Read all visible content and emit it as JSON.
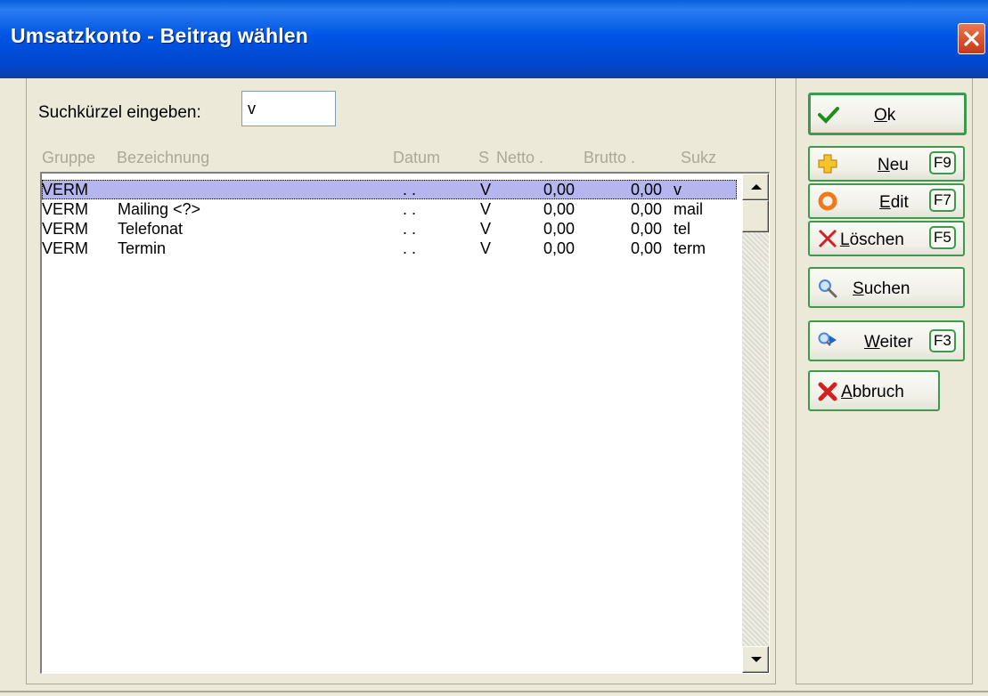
{
  "window": {
    "title": "Umsatzkonto - Beitrag wählen"
  },
  "search": {
    "label": "Suchkürzel eingeben:",
    "value": "v"
  },
  "columns": {
    "gruppe": "Gruppe",
    "bezeichnung": "Bezeichnung",
    "datum": "Datum",
    "s": "S",
    "netto": "Netto .",
    "brutto": "Brutto .",
    "sukz": "Sukz"
  },
  "rows": [
    {
      "gruppe": "VERM",
      "bezeichnung": "",
      "datum": ". .",
      "s": "V",
      "netto": "0,00",
      "brutto": "0,00",
      "sukz": "v"
    },
    {
      "gruppe": "VERM",
      "bezeichnung": "Mailing <?>",
      "datum": ". .",
      "s": "V",
      "netto": "0,00",
      "brutto": "0,00",
      "sukz": "mail"
    },
    {
      "gruppe": "VERM",
      "bezeichnung": "Telefonat",
      "datum": ". .",
      "s": "V",
      "netto": "0,00",
      "brutto": "0,00",
      "sukz": "tel"
    },
    {
      "gruppe": "VERM",
      "bezeichnung": "Termin",
      "datum": ". .",
      "s": "V",
      "netto": "0,00",
      "brutto": "0,00",
      "sukz": "term"
    }
  ],
  "buttons": {
    "ok": {
      "label": "Ok",
      "mnemonic": "O",
      "rest": "k"
    },
    "neu": {
      "mnemonic": "N",
      "rest": "eu",
      "key": "F9"
    },
    "edit": {
      "mnemonic": "E",
      "rest": "dit",
      "key": "F7"
    },
    "loeschen": {
      "mnemonic": "L",
      "rest": "öschen",
      "key": "F5"
    },
    "suchen": {
      "mnemonic": "S",
      "rest": "uchen"
    },
    "weiter": {
      "mnemonic": "W",
      "rest": "eiter",
      "key": "F3"
    },
    "abbruch": {
      "mnemonic": "A",
      "rest": "bbruch"
    }
  },
  "colors": {
    "title_bar": "#0055e5",
    "selection": "#b5b5f0",
    "button_border": "#3c9a4e"
  }
}
